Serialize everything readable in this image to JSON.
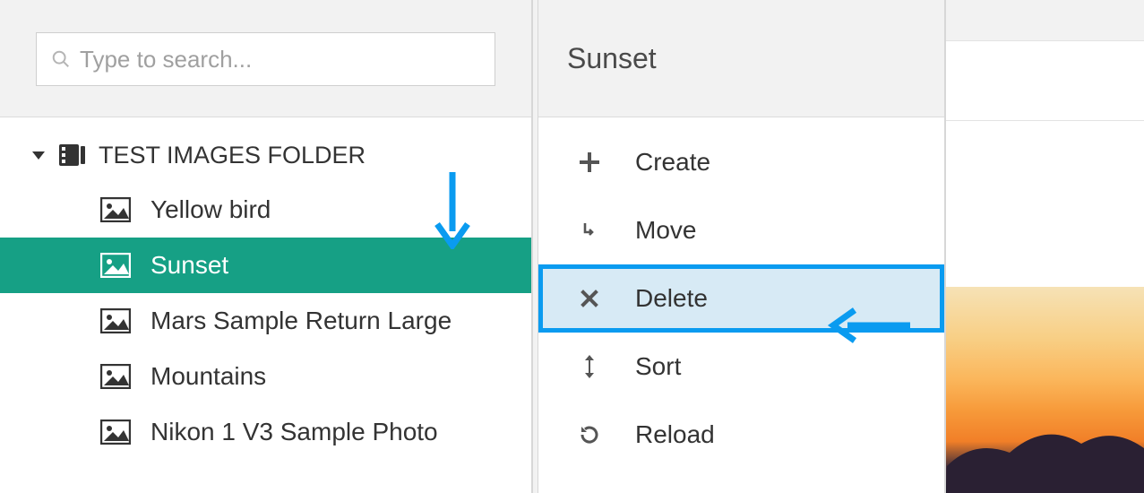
{
  "search": {
    "placeholder": "Type to search..."
  },
  "folder": {
    "name": "TEST IMAGES FOLDER",
    "items": [
      {
        "label": "Yellow bird"
      },
      {
        "label": "Sunset"
      },
      {
        "label": "Mars Sample Return Large"
      },
      {
        "label": "Mountains"
      },
      {
        "label": "Nikon 1 V3 Sample Photo"
      }
    ],
    "selected_index": 1
  },
  "context": {
    "title": "Sunset",
    "menu": [
      {
        "label": "Create",
        "icon": "plus-icon"
      },
      {
        "label": "Move",
        "icon": "move-icon"
      },
      {
        "label": "Delete",
        "icon": "x-icon"
      },
      {
        "label": "Sort",
        "icon": "sort-icon"
      },
      {
        "label": "Reload",
        "icon": "reload-icon"
      }
    ],
    "highlight_index": 2
  },
  "annotation": {
    "color": "#0a9bf0"
  }
}
